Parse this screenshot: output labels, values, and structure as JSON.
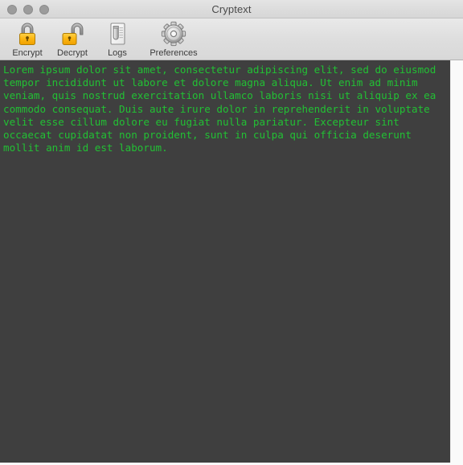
{
  "window": {
    "title": "Cryptext",
    "traffic_lights": [
      {
        "name": "close-button",
        "color": "#9c9c9c"
      },
      {
        "name": "minimize-button",
        "color": "#9c9c9c"
      },
      {
        "name": "zoom-button",
        "color": "#9c9c9c"
      }
    ]
  },
  "toolbar": {
    "items": [
      {
        "label": "Encrypt",
        "icon": "lock-closed-icon"
      },
      {
        "label": "Decrypt",
        "icon": "lock-open-icon"
      },
      {
        "label": "Logs",
        "icon": "document-log-icon"
      },
      {
        "label": "Preferences",
        "icon": "gear-icon"
      }
    ]
  },
  "editor": {
    "text": "Lorem ipsum dolor sit amet, consectetur adipiscing elit, sed do eiusmod tempor incididunt ut labore et dolore magna aliqua. Ut enim ad minim veniam, quis nostrud exercitation ullamco laboris nisi ut aliquip ex ea commodo consequat. Duis aute irure dolor in reprehenderit in voluptate velit esse cillum dolore eu fugiat nulla pariatur. Excepteur sint occaecat cupidatat non proident, sunt in culpa qui officia deserunt mollit anim id est laborum.",
    "text_color": "#22c034",
    "background_color": "#3f3f3f"
  }
}
